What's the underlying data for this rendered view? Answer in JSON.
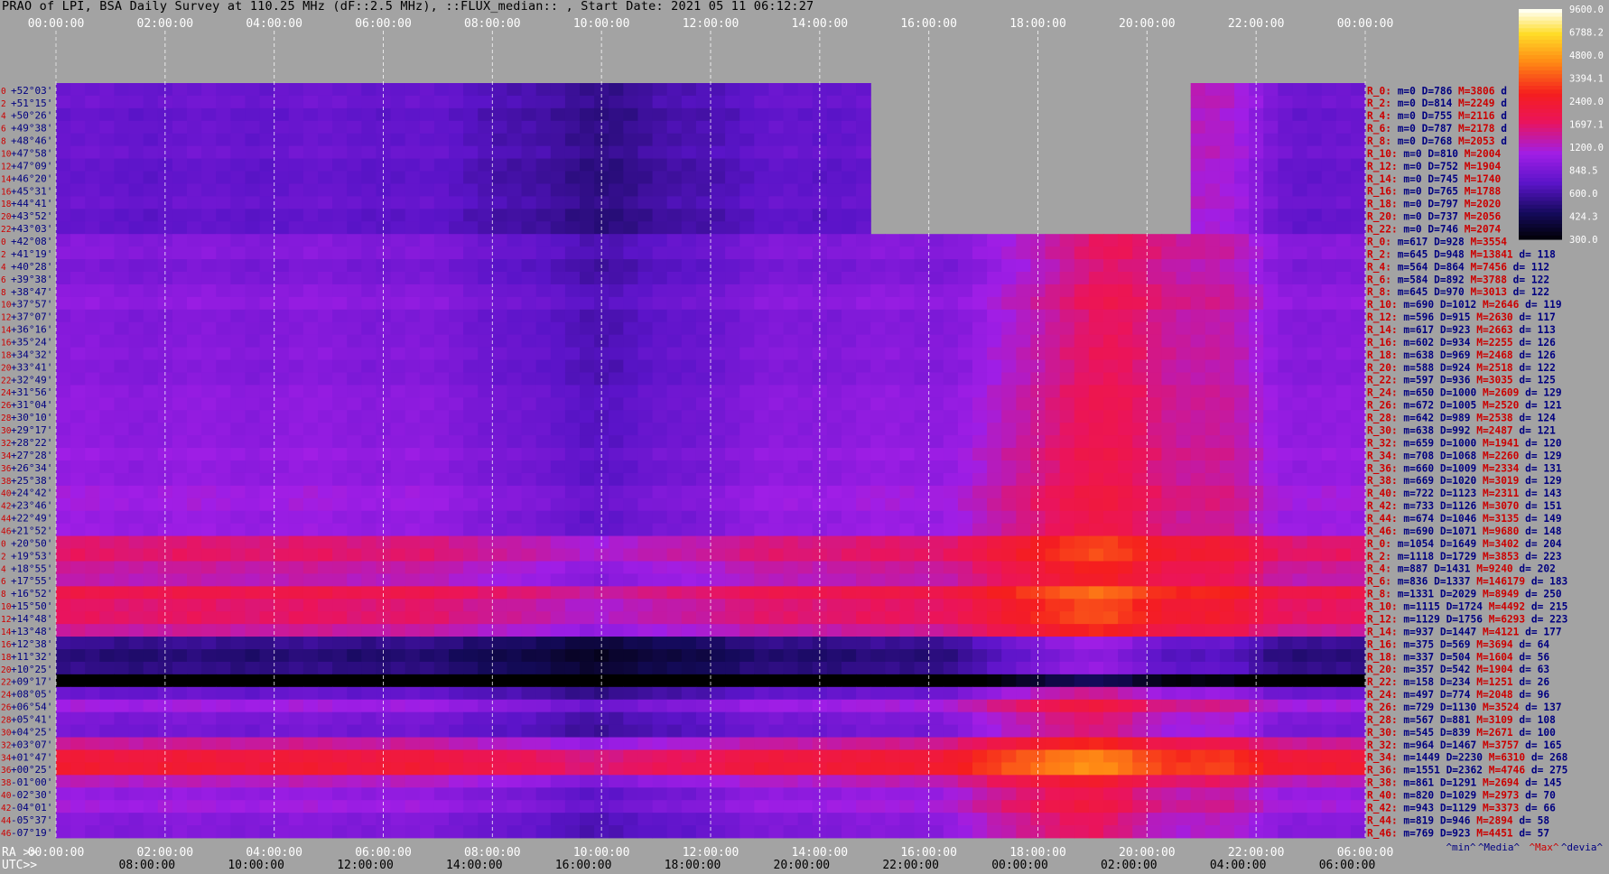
{
  "title": "PRAO of LPI, BSA Daily Survey at 110.25 MHz (dF::2.5 MHz), ::FLUX_median:: , Start Date: 2021 05 11 06:12:27",
  "colors": {
    "background": "#a3a3a3",
    "dec_label": "#000080",
    "row_index": "#cc0000",
    "stat_name": "#cc0000",
    "stat_value": "#000080",
    "stat_max": "#cc0000"
  },
  "chart_data": {
    "type": "heatmap",
    "colormap": "black-blue-purple-red-orange-yellow-white",
    "colorbar": {
      "ticks": [
        "9600.0",
        "6788.2",
        "4800.0",
        "3394.1",
        "2400.0",
        "1697.1",
        "1200.0",
        "848.5",
        "600.0",
        "424.3",
        "300.0"
      ]
    },
    "top_axis": {
      "ticks": [
        "00:00:00",
        "02:00:00",
        "04:00:00",
        "06:00:00",
        "08:00:00",
        "10:00:00",
        "12:00:00",
        "14:00:00",
        "16:00:00",
        "18:00:00",
        "20:00:00",
        "22:00:00",
        "00:00:00"
      ]
    },
    "bottom_axis": {
      "ra_prefix": "RA >>",
      "utc_prefix": "UTC>>",
      "ra_ticks": [
        "00:00:00",
        "02:00:00",
        "04:00:00",
        "06:00:00",
        "08:00:00",
        "10:00:00",
        "12:00:00",
        "14:00:00",
        "16:00:00",
        "18:00:00",
        "20:00:00",
        "22:00:00",
        "06:00:00"
      ],
      "utc_ticks": [
        "08:00:00",
        "10:00:00",
        "12:00:00",
        "14:00:00",
        "16:00:00",
        "18:00:00",
        "20:00:00",
        "22:00:00",
        "00:00:00",
        "02:00:00",
        "04:00:00",
        "06:00:00"
      ]
    },
    "row_indices": [
      "0",
      "2",
      "4",
      "6",
      "8",
      "10",
      "12",
      "14",
      "16",
      "18",
      "20",
      "22",
      "0",
      "2",
      "4",
      "6",
      "8",
      "10",
      "12",
      "14",
      "16",
      "18",
      "20",
      "22",
      "24",
      "26",
      "28",
      "30",
      "32",
      "34",
      "36",
      "38",
      "40",
      "42",
      "44",
      "46",
      "0",
      "2",
      "4",
      "6",
      "8",
      "10",
      "12",
      "14",
      "16",
      "18",
      "20",
      "22",
      "24",
      "26",
      "28",
      "30",
      "32",
      "34",
      "36",
      "38",
      "40",
      "42",
      "44",
      "46"
    ],
    "declinations": [
      "+52°03'",
      "+51°15'",
      "+50°26'",
      "+49°38'",
      "+48°46'",
      "+47°58'",
      "+47°09'",
      "+46°20'",
      "+45°31'",
      "+44°41'",
      "+43°52'",
      "+43°03'",
      "+42°08'",
      "+41°19'",
      "+40°28'",
      "+39°38'",
      "+38°47'",
      "+37°57'",
      "+37°07'",
      "+36°16'",
      "+35°24'",
      "+34°32'",
      "+33°41'",
      "+32°49'",
      "+31°56'",
      "+31°04'",
      "+30°10'",
      "+29°17'",
      "+28°22'",
      "+27°28'",
      "+26°34'",
      "+25°38'",
      "+24°42'",
      "+23°46'",
      "+22°49'",
      "+21°52'",
      "+20°50'",
      "+19°53'",
      "+18°55'",
      "+17°55'",
      "+16°52'",
      "+15°50'",
      "+14°48'",
      "+13°48'",
      "+12°38'",
      "+11°32'",
      "+10°25'",
      "+09°17'",
      "+08°05'",
      "+06°54'",
      "+05°41'",
      "+04°25'",
      "+03°07'",
      "+01°47'",
      "+00°25'",
      "-01°00'",
      "-02°30'",
      "-04°01'",
      "-05°37'",
      "-07°19'"
    ],
    "row_stats": [
      "R_0: m=0 D=786 M=3806 d",
      "R_2: m=0 D=814 M=2249 d",
      "R_4: m=0 D=755 M=2116 d",
      "R_6: m=0 D=787 M=2178 d",
      "R_8: m=0 D=768 M=2053 d",
      "R_10: m=0 D=810 M=2004",
      "R_12: m=0 D=752 M=1904",
      "R_14: m=0 D=745 M=1740",
      "R_16: m=0 D=765 M=1788",
      "R_18: m=0 D=797 M=2020",
      "R_20: m=0 D=737 M=2056",
      "R_22: m=0 D=746 M=2074",
      "R_0: m=617 D=928 M=3554",
      "R_2: m=645 D=948 M=13841 d= 118",
      "R_4: m=564 D=864 M=7456 d= 112",
      "R_6: m=584 D=892 M=3788 d= 122",
      "R_8: m=645 D=970 M=3013 d= 122",
      "R_10: m=690 D=1012 M=2646 d= 119",
      "R_12: m=596 D=915 M=2630 d= 117",
      "R_14: m=617 D=923 M=2663 d= 113",
      "R_16: m=602 D=934 M=2255 d= 126",
      "R_18: m=638 D=969 M=2468 d= 126",
      "R_20: m=588 D=924 M=2518 d= 122",
      "R_22: m=597 D=936 M=3035 d= 125",
      "R_24: m=650 D=1000 M=2609 d= 129",
      "R_26: m=672 D=1005 M=2520 d= 121",
      "R_28: m=642 D=989 M=2538 d= 124",
      "R_30: m=638 D=992 M=2487 d= 121",
      "R_32: m=659 D=1000 M=1941 d= 120",
      "R_34: m=708 D=1068 M=2260 d= 129",
      "R_36: m=660 D=1009 M=2334 d= 131",
      "R_38: m=669 D=1020 M=3019 d= 129",
      "R_40: m=722 D=1123 M=2311 d= 143",
      "R_42: m=733 D=1126 M=3070 d= 151",
      "R_44: m=674 D=1046 M=3135 d= 149",
      "R_46: m=690 D=1071 M=9680 d= 148",
      "R_0: m=1054 D=1649 M=3402 d= 204",
      "R_2: m=1118 D=1729 M=3853 d= 223",
      "R_4: m=887 D=1431 M=9240 d= 202",
      "R_6: m=836 D=1337 M=146179 d= 183",
      "R_8: m=1331 D=2029 M=8949 d= 250",
      "R_10: m=1115 D=1724 M=4492 d= 215",
      "R_12: m=1129 D=1756 M=6293 d= 223",
      "R_14: m=937 D=1447 M=4121 d= 177",
      "R_16: m=375 D=569 M=3694 d= 64",
      "R_18: m=337 D=504 M=1604 d= 56",
      "R_20: m=357 D=542 M=1904 d= 63",
      "R_22: m=158 D=234 M=1251 d= 26",
      "R_24: m=497 D=774 M=2048 d= 96",
      "R_26: m=729 D=1130 M=3524 d= 137",
      "R_28: m=567 D=881 M=3109 d= 108",
      "R_30: m=545 D=839 M=2671 d= 100",
      "R_32: m=964 D=1467 M=3757 d= 165",
      "R_34: m=1449 D=2230 M=6310 d= 268",
      "R_36: m=1551 D=2362 M=4746 d= 275",
      "R_38: m=861 D=1291 M=2694 d= 145",
      "R_40: m=820 D=1029 M=2973 d= 70",
      "R_42: m=943 D=1129 M=3373 d= 66",
      "R_44: m=819 D=946 M=2894 d= 58",
      "R_46: m=769 D=923 M=4451 d= 57"
    ],
    "stats_legend": [
      "^min^",
      "^Media^",
      "^Max^",
      "^devia^"
    ]
  }
}
